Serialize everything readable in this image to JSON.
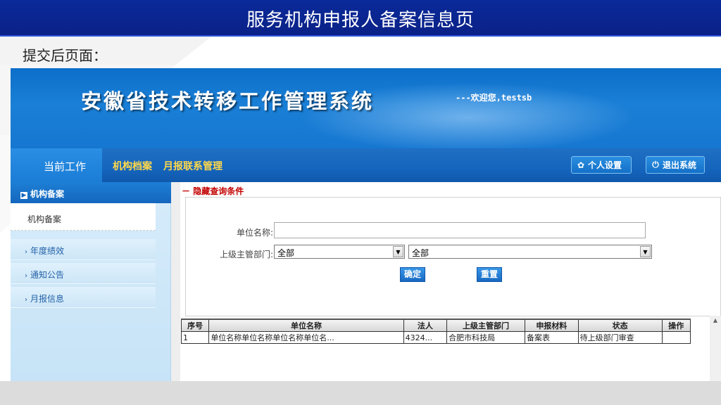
{
  "slide": {
    "title": "服务机构申报人备案信息页",
    "subtitle": "提交后页面："
  },
  "header": {
    "system_title": "安徽省技术转移工作管理系统",
    "welcome": "---欢迎您,testsb"
  },
  "nav": {
    "tabs": [
      {
        "label": "当前工作"
      },
      {
        "label": "机构档案"
      },
      {
        "label": "月报联系管理"
      }
    ],
    "settings_label": "个人设置",
    "settings_icon": "gear-icon",
    "logout_label": "退出系统",
    "logout_icon": "power-icon"
  },
  "sidebar": {
    "header": "机构备案",
    "sub_item": "机构备案",
    "items": [
      {
        "label": "年度绩效"
      },
      {
        "label": "通知公告"
      },
      {
        "label": "月报信息"
      }
    ]
  },
  "query": {
    "toggle_label": "隐藏查询条件",
    "unit_label": "单位名称:",
    "unit_value": "",
    "dept_label": "上级主管部门:",
    "dept_select_1": "全部",
    "dept_select_2": "全部",
    "confirm_label": "确定",
    "reset_label": "重置"
  },
  "table": {
    "columns": [
      "序号",
      "单位名称",
      "法人",
      "上级主管部门",
      "申报材料",
      "状态",
      "操作"
    ],
    "rows": [
      [
        "1",
        "单位名称单位名称单位名称单位名...",
        "4324...",
        "合肥市科技局",
        "备案表",
        "待上级部门审查",
        ""
      ]
    ]
  },
  "colors": {
    "slide_title_bg": "#0b2187",
    "header_blue": "#1677d1",
    "nav_active_yellow": "#ffd84a",
    "toggle_red": "#c20000"
  }
}
